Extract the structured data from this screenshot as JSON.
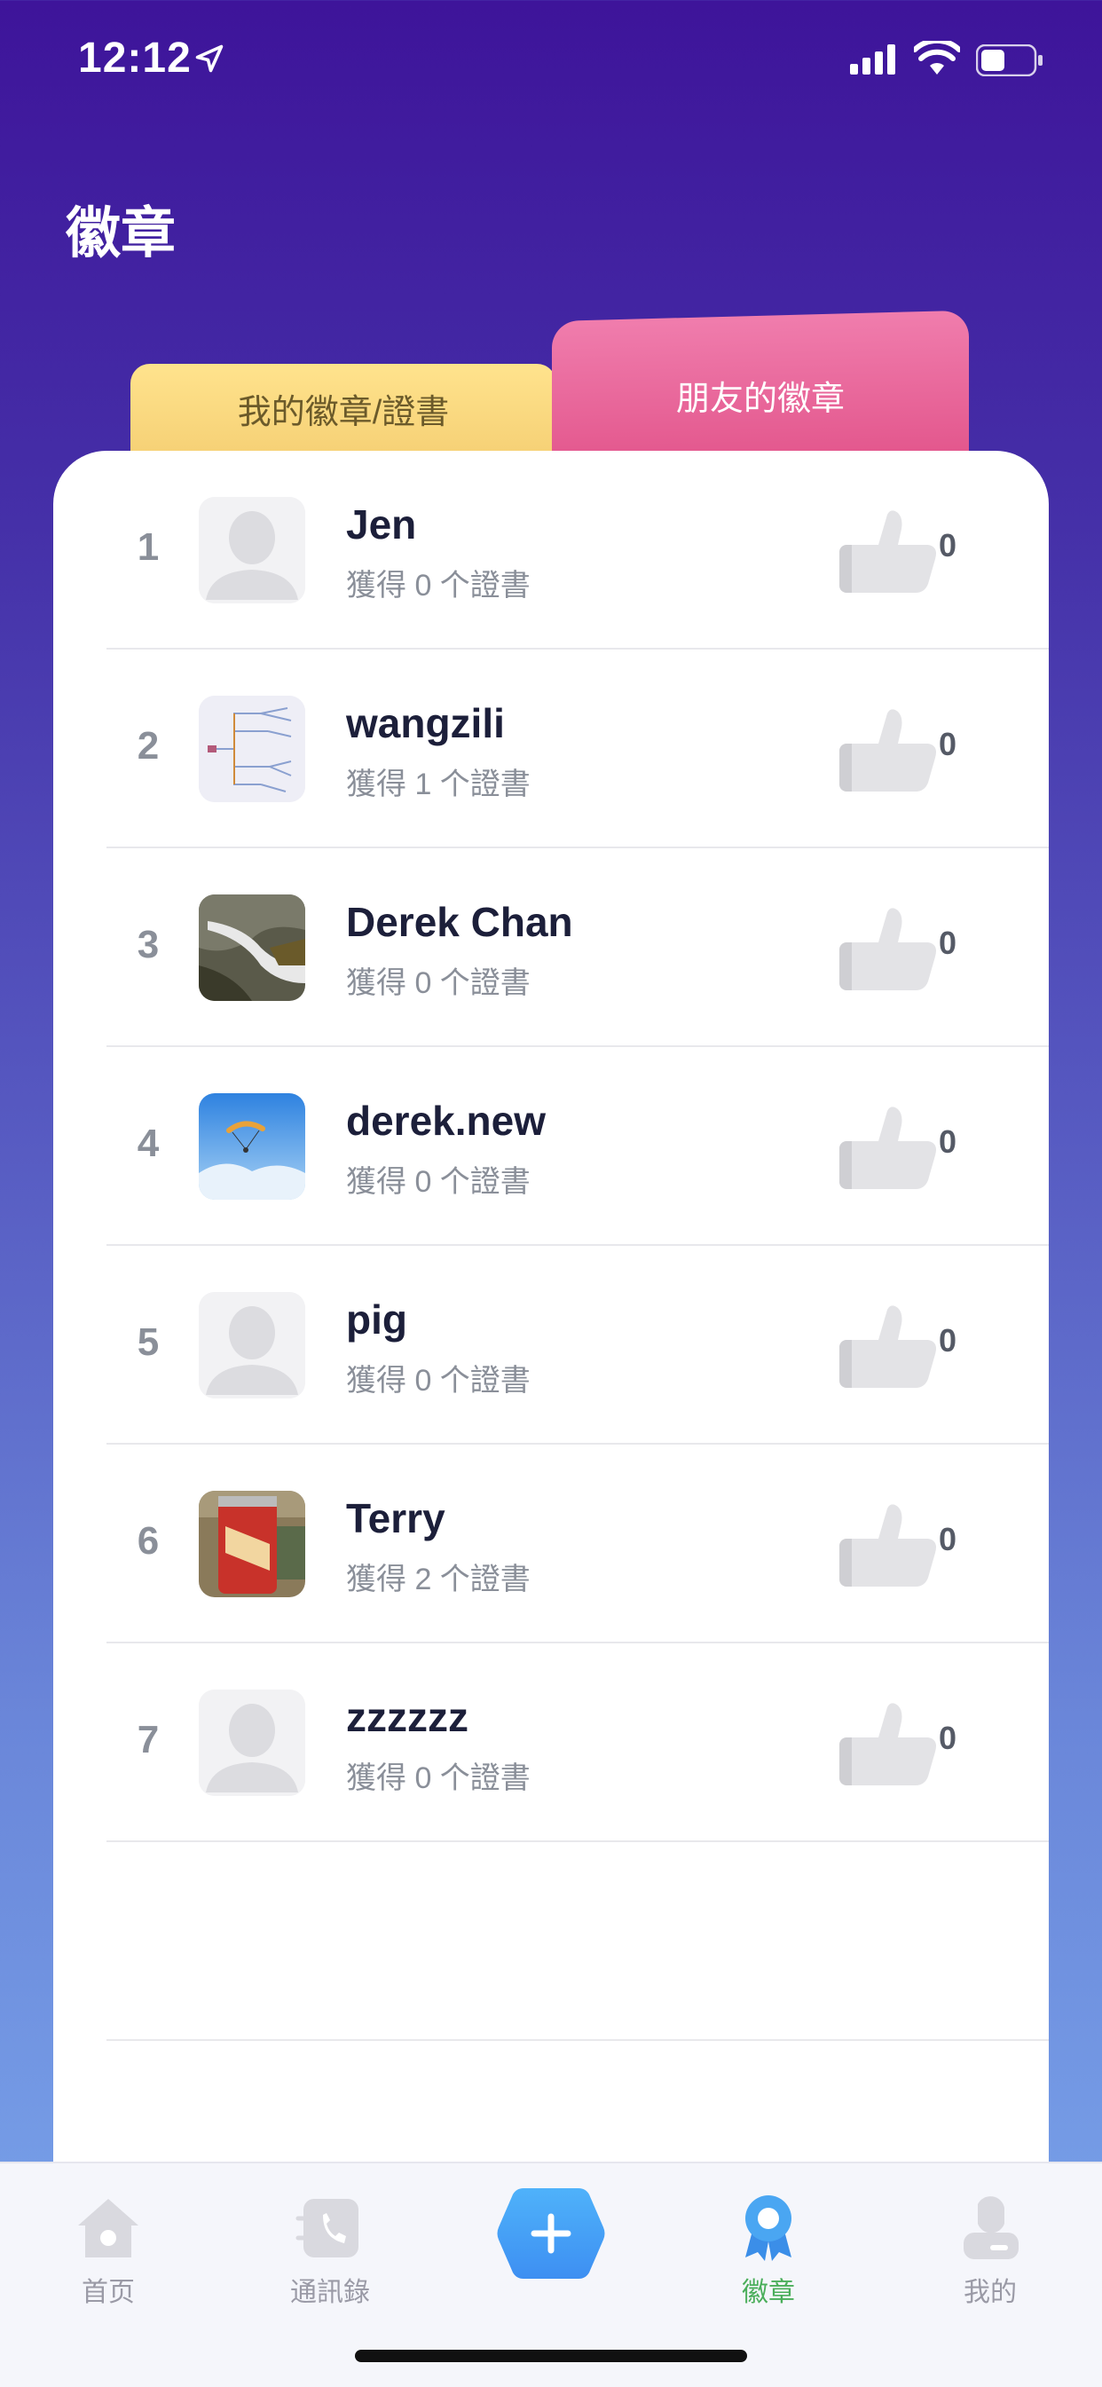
{
  "status_bar": {
    "time": "12:12"
  },
  "page_title": "徽章",
  "tabs": {
    "mine": "我的徽章/證書",
    "friends": "朋友的徽章"
  },
  "friends": [
    {
      "rank": "1",
      "name": "Jen",
      "certs": "獲得 0 个證書",
      "likes": "0",
      "avatar": "default"
    },
    {
      "rank": "2",
      "name": "wangzili",
      "certs": "獲得 1 个證書",
      "likes": "0",
      "avatar": "mindmap"
    },
    {
      "rank": "3",
      "name": "Derek Chan",
      "certs": "獲得 0 个證書",
      "likes": "0",
      "avatar": "waterfall"
    },
    {
      "rank": "4",
      "name": "derek.new",
      "certs": "獲得 0 个證書",
      "likes": "0",
      "avatar": "paraglider"
    },
    {
      "rank": "5",
      "name": "pig",
      "certs": "獲得 0 个證書",
      "likes": "0",
      "avatar": "default"
    },
    {
      "rank": "6",
      "name": "Terry",
      "certs": "獲得 2 个證書",
      "likes": "0",
      "avatar": "can"
    },
    {
      "rank": "7",
      "name": "zzzzzz",
      "certs": "獲得 0 个證書",
      "likes": "0",
      "avatar": "default"
    }
  ],
  "tabbar": {
    "home": "首页",
    "contacts": "通訊錄",
    "badges": "徽章",
    "me": "我的"
  },
  "colors": {
    "active_tab": "#4aae5a",
    "friends_tab": "#e3578d",
    "mine_tab": "#f6d176",
    "add_button": "#3d9cf5"
  }
}
